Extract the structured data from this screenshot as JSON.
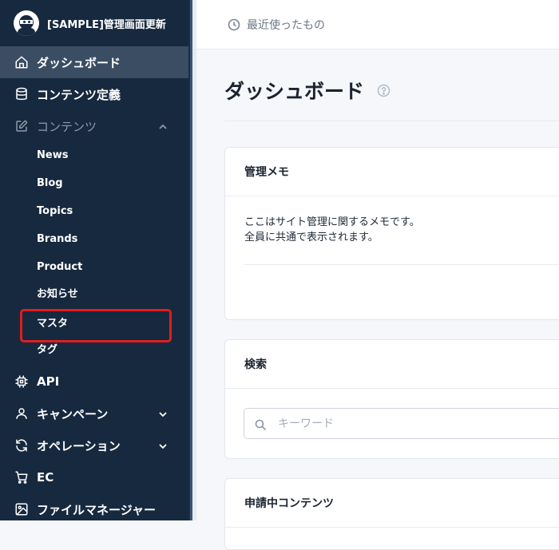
{
  "brand": {
    "title": "[SAMPLE]管理画面更新"
  },
  "topbar": {
    "recent_label": "最近使ったもの"
  },
  "sidebar": {
    "items": [
      {
        "label": "ダッシュボード",
        "icon": "home-icon"
      },
      {
        "label": "コンテンツ定義",
        "icon": "database-icon"
      },
      {
        "label": "コンテンツ",
        "icon": "edit-icon"
      },
      {
        "label": "API",
        "icon": "chip-icon"
      },
      {
        "label": "キャンペーン",
        "icon": "user-icon"
      },
      {
        "label": "オペレーション",
        "icon": "refresh-icon"
      },
      {
        "label": "EC",
        "icon": "cart-icon"
      },
      {
        "label": "ファイルマネージャー",
        "icon": "image-icon"
      }
    ],
    "content_subitems": [
      {
        "label": "News"
      },
      {
        "label": "Blog"
      },
      {
        "label": "Topics"
      },
      {
        "label": "Brands"
      },
      {
        "label": "Product"
      },
      {
        "label": "お知らせ"
      },
      {
        "label": "マスタ"
      },
      {
        "label": "タグ"
      }
    ]
  },
  "main": {
    "title": "ダッシュボード",
    "memo_card": {
      "title": "管理メモ",
      "line1": "ここはサイト管理に関するメモです。",
      "line2": "全員に共通で表示されます。"
    },
    "search_card": {
      "title": "検索",
      "placeholder": "キーワード"
    },
    "pending_card": {
      "title": "申請中コンテンツ"
    }
  },
  "colors": {
    "sidebar_bg": "#17293f",
    "active_bg": "#3b4d63",
    "highlight": "#e11d1d"
  }
}
